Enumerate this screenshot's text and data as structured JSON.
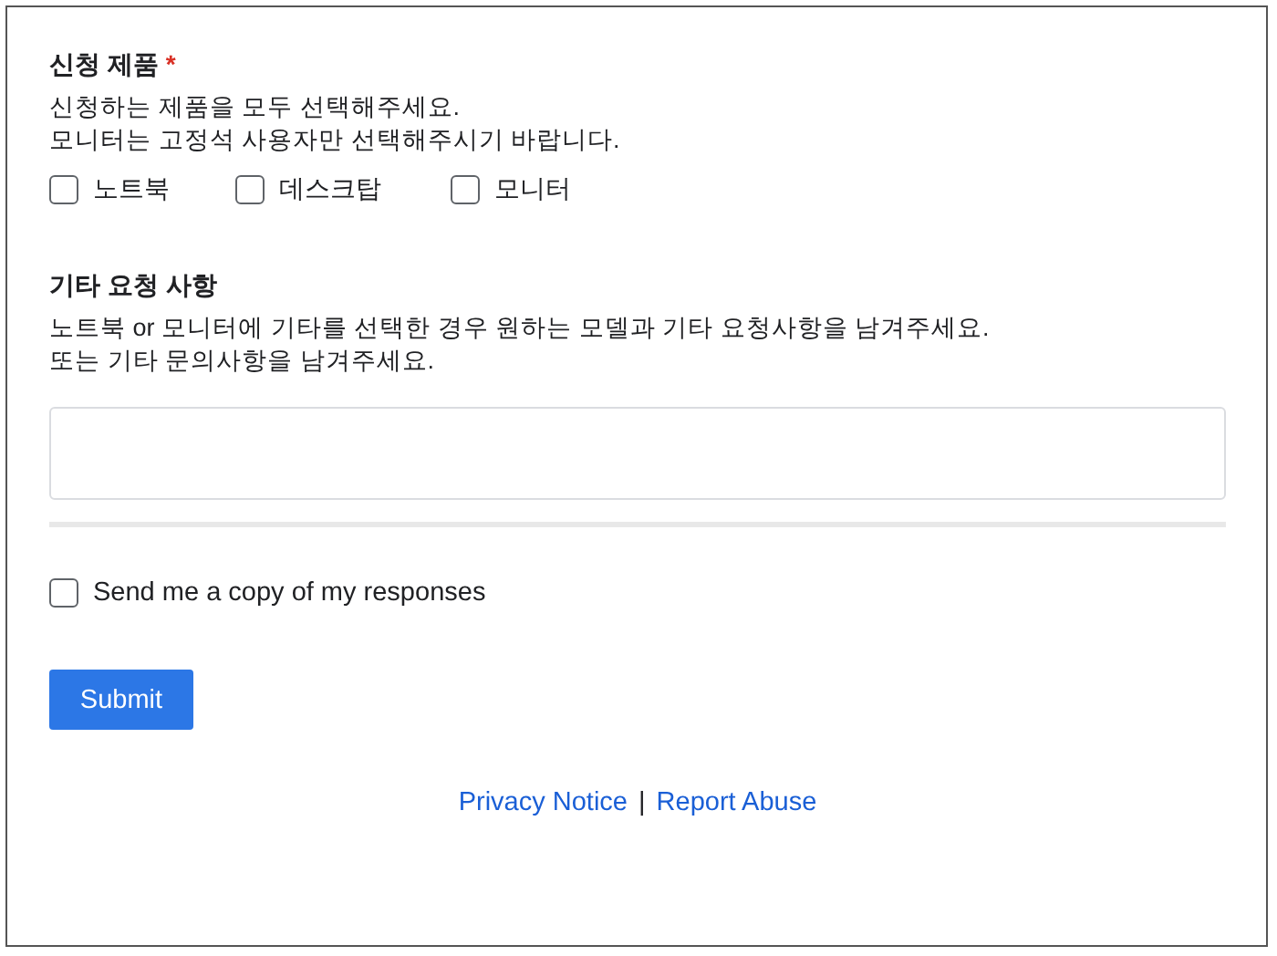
{
  "sections": [
    {
      "kind": "checkboxes",
      "title": "신청 제품",
      "required_mark": "*",
      "description": [
        "신청하는 제품을 모두 선택해주세요.",
        "모니터는 고정석 사용자만 선택해주시기 바랍니다."
      ],
      "options": [
        {
          "label": "노트북",
          "checked": false
        },
        {
          "label": "데스크탑",
          "checked": false
        },
        {
          "label": "모니터",
          "checked": false
        }
      ]
    },
    {
      "kind": "text",
      "title": "기타 요청 사항",
      "description": [
        "노트북 or 모니터에 기타를 선택한 경우 원하는 모델과 기타 요청사항을 남겨주세요.",
        "또는 기타 문의사항을 남겨주세요."
      ]
    }
  ],
  "copy_option": {
    "label": "Send me a copy of my responses",
    "checked": false
  },
  "submit": "Submit",
  "footer": {
    "links": [
      "Privacy Notice",
      "Report Abuse"
    ],
    "separator": "|"
  }
}
